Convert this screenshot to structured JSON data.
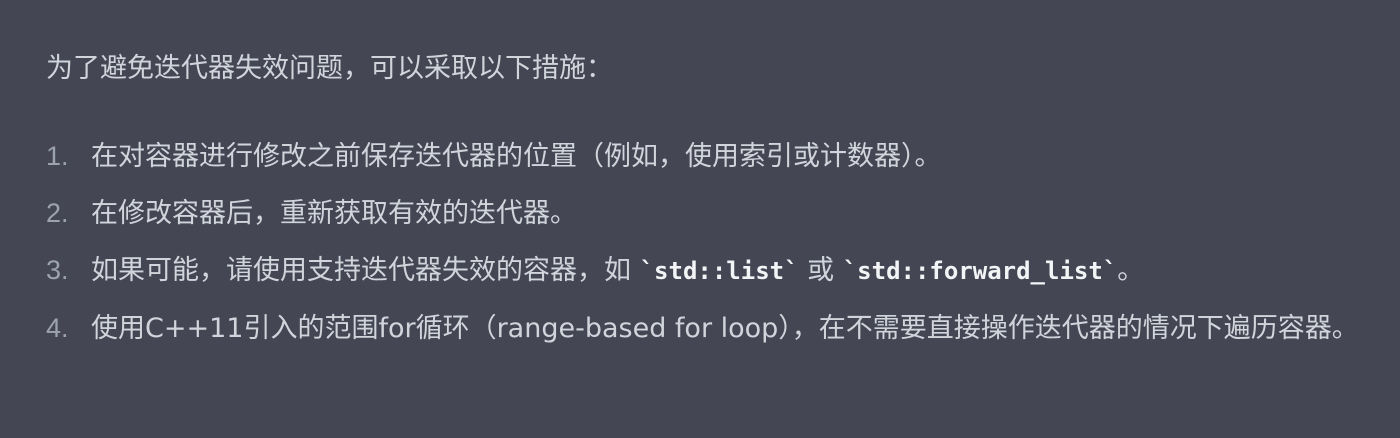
{
  "message": {
    "intro": "为了避免迭代器失效问题，可以采取以下措施：",
    "items": [
      {
        "number": "1.",
        "text": "在对容器进行修改之前保存迭代器的位置（例如，使用索引或计数器）。"
      },
      {
        "number": "2.",
        "text": "在修改容器后，重新获取有效的迭代器。"
      },
      {
        "number": "3.",
        "text_before": "如果可能，请使用支持迭代器失效的容器，如 ",
        "code1": "`std::list`",
        "text_middle": " 或 ",
        "code2": "`std::forward_list`",
        "text_after": "。"
      },
      {
        "number": "4.",
        "text": "使用C++11引入的范围for循环（range-based for loop），在不需要直接操作迭代器的情况下遍历容器。"
      }
    ]
  },
  "colors": {
    "background": "#444654",
    "text": "#d1d5db",
    "list_number": "#9ca3af",
    "code": "#f3f4f6"
  }
}
